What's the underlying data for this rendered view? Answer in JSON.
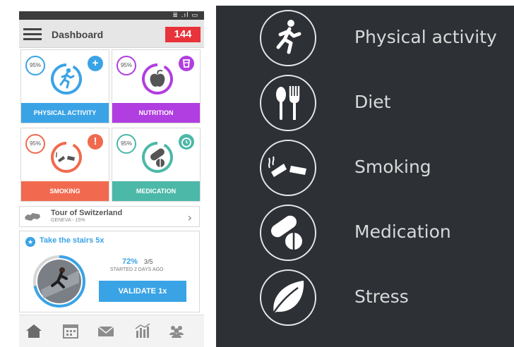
{
  "app": {
    "title": "Dashboard",
    "badge_count": "144",
    "status_icons": "≣ .ıl ▭"
  },
  "tiles": [
    {
      "percent": "95%",
      "label": "PHYSICAL ACTIVITY",
      "color": "#3aa3e6",
      "corner_icon": "plus-icon",
      "corner_glyph": "+"
    },
    {
      "percent": "95%",
      "label": "NUTRITION",
      "color": "#b13ee0",
      "corner_icon": "cup-icon",
      "corner_glyph": ""
    },
    {
      "percent": "95%",
      "label": "SMOKING",
      "color": "#f16a4f",
      "corner_icon": "alert-icon",
      "corner_glyph": "!"
    },
    {
      "percent": "95%",
      "label": "MEDICATION",
      "color": "#4cb8a8",
      "corner_icon": "alarm-clock-icon",
      "corner_glyph": ""
    }
  ],
  "tour": {
    "name": "Tour of Switzerland",
    "sub": "GENEVA - 15%"
  },
  "challenge": {
    "title": "Take the stairs 5x",
    "percent": "72%",
    "fraction": "3/5",
    "started": "STARTED 2 DAYS AGO",
    "progress": 0.72,
    "button": "VALIDATE 1x"
  },
  "nav": [
    "home-icon",
    "calendar-icon",
    "mail-icon",
    "stats-icon",
    "community-icon"
  ],
  "categories": [
    {
      "label": "Physical activity",
      "icon": "running-person-icon"
    },
    {
      "label": "Diet",
      "icon": "spoon-fork-icon"
    },
    {
      "label": "Smoking",
      "icon": "broken-cigarette-icon"
    },
    {
      "label": "Medication",
      "icon": "pills-icon"
    },
    {
      "label": "Stress",
      "icon": "leaf-icon"
    }
  ],
  "colors": {
    "panel_bg": "#2d3035",
    "badge": "#e8333a",
    "accent_blue": "#3aa3e6"
  }
}
